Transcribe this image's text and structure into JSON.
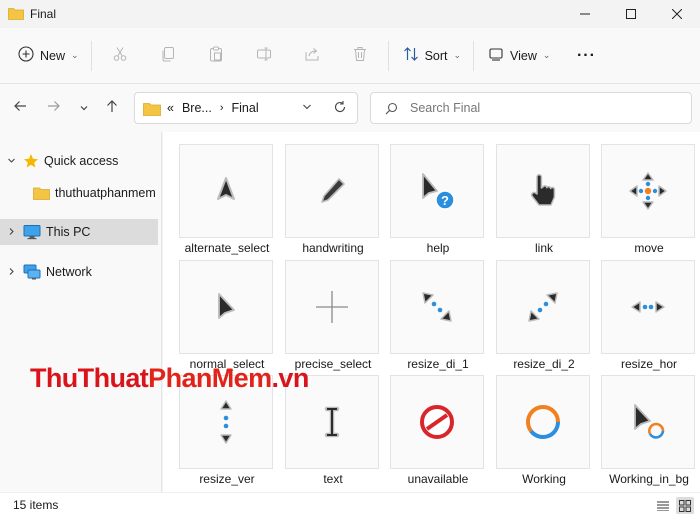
{
  "window": {
    "title": "Final"
  },
  "toolbar": {
    "new_label": "New",
    "sort_label": "Sort",
    "view_label": "View",
    "more_label": "···"
  },
  "address": {
    "overflow": "«",
    "crumbs": [
      "Bre...",
      "Final"
    ],
    "search_placeholder": "Search Final"
  },
  "sidebar": {
    "items": [
      {
        "label": "Quick access",
        "icon": "star-icon"
      },
      {
        "label": "thuthuatphanmem",
        "icon": "folder-icon"
      },
      {
        "label": "This PC",
        "icon": "monitor-icon"
      },
      {
        "label": "Network",
        "icon": "network-icon"
      }
    ]
  },
  "files": [
    {
      "name": "alternate_select",
      "icon": "up-arrow-cursor-icon"
    },
    {
      "name": "handwriting",
      "icon": "pen-cursor-icon"
    },
    {
      "name": "help",
      "icon": "help-cursor-icon"
    },
    {
      "name": "link",
      "icon": "hand-cursor-icon"
    },
    {
      "name": "move",
      "icon": "move-cursor-icon"
    },
    {
      "name": "normal_select",
      "icon": "arrow-cursor-icon"
    },
    {
      "name": "precise_select",
      "icon": "crosshair-cursor-icon"
    },
    {
      "name": "resize_di_1",
      "icon": "resize-diagonal-1-icon"
    },
    {
      "name": "resize_di_2",
      "icon": "resize-diagonal-2-icon"
    },
    {
      "name": "resize_hor",
      "icon": "resize-horizontal-icon"
    },
    {
      "name": "resize_ver",
      "icon": "resize-vertical-icon"
    },
    {
      "name": "text",
      "icon": "text-beam-cursor-icon"
    },
    {
      "name": "unavailable",
      "icon": "unavailable-cursor-icon"
    },
    {
      "name": "Working",
      "icon": "busy-cursor-icon"
    },
    {
      "name": "Working_in_bg",
      "icon": "working-in-background-cursor-icon"
    }
  ],
  "status": {
    "item_count": "15 items"
  },
  "watermark": {
    "part1": "ThuThuat",
    "part2": "PhanMem",
    "part3": ".vn"
  },
  "colors": {
    "folder": "#f4c542",
    "accent": "#0078d4",
    "cursor_blue": "#2b8fe0",
    "cursor_orange": "#f08020",
    "unavailable_red": "#d9262b"
  }
}
